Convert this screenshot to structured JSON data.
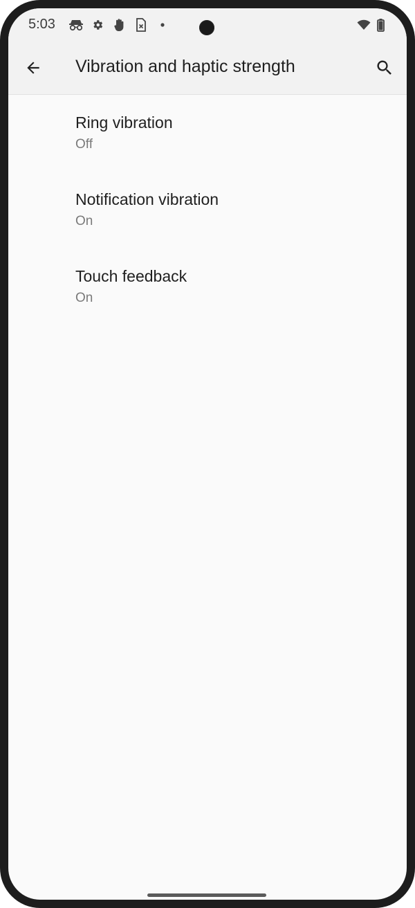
{
  "status_bar": {
    "time": "5:03",
    "icons": [
      "incognito-icon",
      "settings-gear-icon",
      "hand-icon",
      "sim-card-off-icon",
      "dot-icon",
      "wifi-icon",
      "battery-icon"
    ]
  },
  "app_bar": {
    "title": "Vibration and haptic strength",
    "back_icon": "arrow-back-icon",
    "search_icon": "search-icon"
  },
  "settings": [
    {
      "title": "Ring vibration",
      "summary": "Off"
    },
    {
      "title": "Notification vibration",
      "summary": "On"
    },
    {
      "title": "Touch feedback",
      "summary": "On"
    }
  ],
  "colors": {
    "background": "#fafafa",
    "app_bar": "#f2f2f2",
    "title_text": "#1f1f1f",
    "summary_text": "#7a7a7a"
  }
}
